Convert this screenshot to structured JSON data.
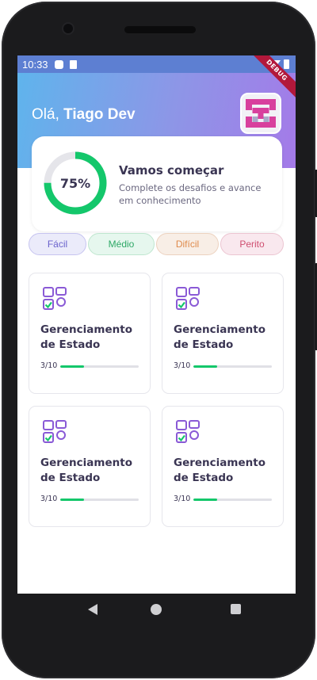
{
  "status_bar": {
    "time": "10:33",
    "debug_label": "DEBUG"
  },
  "header": {
    "greeting_prefix": "Olá, ",
    "user_name": "Tiago Dev"
  },
  "progress": {
    "percent": 75,
    "percent_label": "75%",
    "title": "Vamos começar",
    "subtitle": "Complete os desafios e avance em conhecimento"
  },
  "levels": [
    {
      "label": "Fácil",
      "color": "#6a62cc"
    },
    {
      "label": "Médio",
      "color": "#2ea866"
    },
    {
      "label": "Difícil",
      "color": "#df8a4b"
    },
    {
      "label": "Perito",
      "color": "#cf4e70"
    }
  ],
  "challenges": [
    {
      "title": "Gerenciamento de Estado",
      "count": "3/10",
      "progress": 0.3
    },
    {
      "title": "Gerenciamento de Estado",
      "count": "3/10",
      "progress": 0.3
    },
    {
      "title": "Gerenciamento de Estado",
      "count": "3/10",
      "progress": 0.3
    },
    {
      "title": "Gerenciamento de Estado",
      "count": "3/10",
      "progress": 0.3
    }
  ],
  "colors": {
    "accent_green": "#14c76b",
    "text_dark": "#3a3553",
    "icon_purple": "#8a5ad6"
  },
  "icons": {
    "challenge": "checklist-grid-icon",
    "avatar": "pixel-logo-icon"
  }
}
